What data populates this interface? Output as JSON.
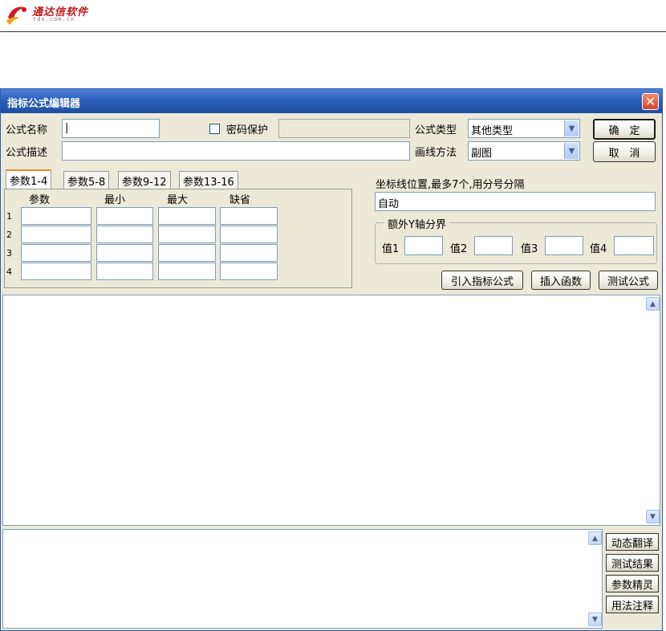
{
  "header": {
    "logo_main": "通达信软件",
    "logo_sub": "tdx.com.cn"
  },
  "window": {
    "title": "指标公式编辑器",
    "close_glyph": "✕"
  },
  "form": {
    "name_label": "公式名称",
    "name_value": "|",
    "password_label": "密码保护",
    "password_value": "",
    "desc_label": "公式描述",
    "desc_value": "",
    "type_label": "公式类型",
    "type_value": "其他类型",
    "draw_label": "画线方法",
    "draw_value": "副图",
    "ok_button": "确　定",
    "cancel_button": "取　消"
  },
  "tabs": [
    "参数1-4",
    "参数5-8",
    "参数9-12",
    "参数13-16"
  ],
  "params": {
    "headers": [
      "参数",
      "最小",
      "最大",
      "缺省"
    ],
    "rows": [
      "1",
      "2",
      "3",
      "4"
    ]
  },
  "axis": {
    "label": "坐标线位置,最多7个,用分号分隔",
    "value": "自动",
    "group_label": "额外Y轴分界",
    "value_labels": [
      "值1",
      "值2",
      "值3",
      "值4"
    ]
  },
  "actions": {
    "import_formula": "引入指标公式",
    "insert_function": "插入函数",
    "test_formula": "测试公式"
  },
  "side_buttons": [
    "动态翻译",
    "测试结果",
    "参数精灵",
    "用法注释"
  ],
  "icons": {
    "scroll_up": "▲",
    "scroll_down": "▼",
    "dropdown": "▼"
  }
}
